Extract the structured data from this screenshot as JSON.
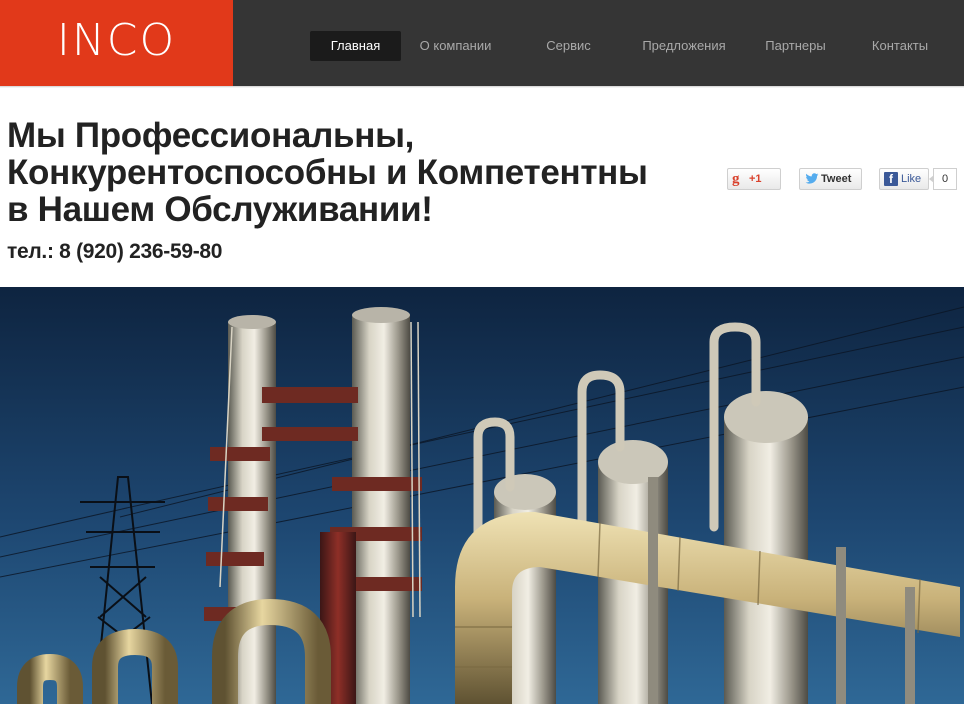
{
  "header": {
    "logo": "INCO",
    "nav": [
      {
        "label": "Главная",
        "active": true
      },
      {
        "label": "О компании",
        "active": false
      },
      {
        "label": "Сервис",
        "active": false
      },
      {
        "label": "Предложения",
        "active": false
      },
      {
        "label": "Партнеры",
        "active": false
      },
      {
        "label": "Контакты",
        "active": false
      }
    ]
  },
  "hero": {
    "headline_lines": [
      "Мы Профессиональны,",
      "Конкурентоспособны и Компетентны",
      "в Нашем Обслуживании!"
    ],
    "phone": "тел.: 8 (920) 236-59-80"
  },
  "social": {
    "gplus_label": "+1",
    "tweet_label": "Tweet",
    "like_label": "Like",
    "like_count": "0"
  },
  "colors": {
    "brand": "#e1391a",
    "header_bg": "#353535",
    "nav_active_bg": "#1b1b1b",
    "sky": "#1a3a5c"
  },
  "image": {
    "subject": "industrial refinery with metal columns and pipes against a blue sky"
  }
}
